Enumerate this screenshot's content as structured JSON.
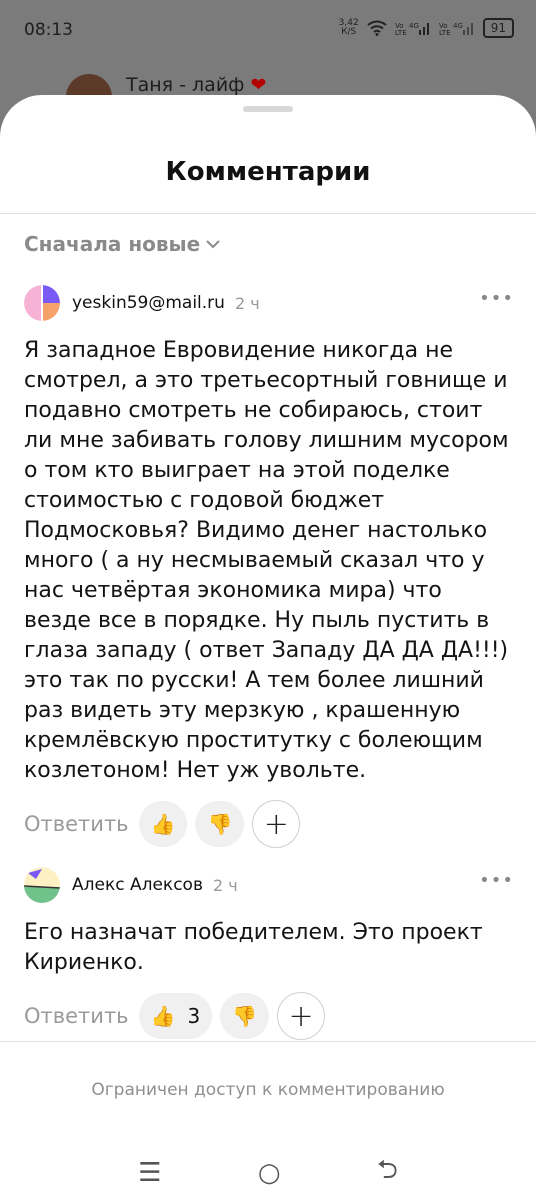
{
  "status_bar": {
    "time": "08:13",
    "speed": "3,42",
    "speed_unit": "К/S",
    "battery": "91"
  },
  "background": {
    "channel_title": "Таня - лайф",
    "heart": "❤"
  },
  "sheet": {
    "title": "Комментарии",
    "sort_label": "Сначала новые",
    "sort_icon": "chevron-down",
    "restricted_text": "Ограничен доступ к комментированию"
  },
  "comments": [
    {
      "author": "yeskin59@mail.ru",
      "ago": "2 ч",
      "text": "Я западное Евровидение никогда не смотрел, а это третьесортный говнище и подавно смотреть не собираюсь, стоит ли мне забивать голову лишним мусором о том кто выиграет на этой поделке стоимостью с годовой бюджет Подмосковья? Видимо денег настолько много ( а ну несмываемый сказал что у нас четвёртая экономика мира) что везде все в порядке. Ну пыль пустить в глаза западу ( ответ  Западу ДА ДА ДА!!!) это так по русски!  А тем более лишний раз видеть эту мерзкую , крашенную кремлёвскую проститутку с болеющим козлетоном! Нет уж увольте.",
      "reply_label": "Ответить",
      "likes": "",
      "avatar_colors": [
        "#f7b3d6",
        "#f6a26a",
        "#7a5af5"
      ]
    },
    {
      "author": "Алекс Алексов",
      "ago": "2 ч",
      "text": "Его назначат победителем. Это проект Кириенко.",
      "reply_label": "Ответить",
      "likes": "3",
      "avatar_colors": [
        "#fdf0c2",
        "#6fc38a",
        "#7a5af5"
      ]
    }
  ],
  "icons": {
    "like": "👍",
    "dislike": "👎",
    "more": "•••",
    "plus": "+"
  },
  "navbar": {
    "menu": "☰",
    "home": "○",
    "back": "⮌"
  }
}
